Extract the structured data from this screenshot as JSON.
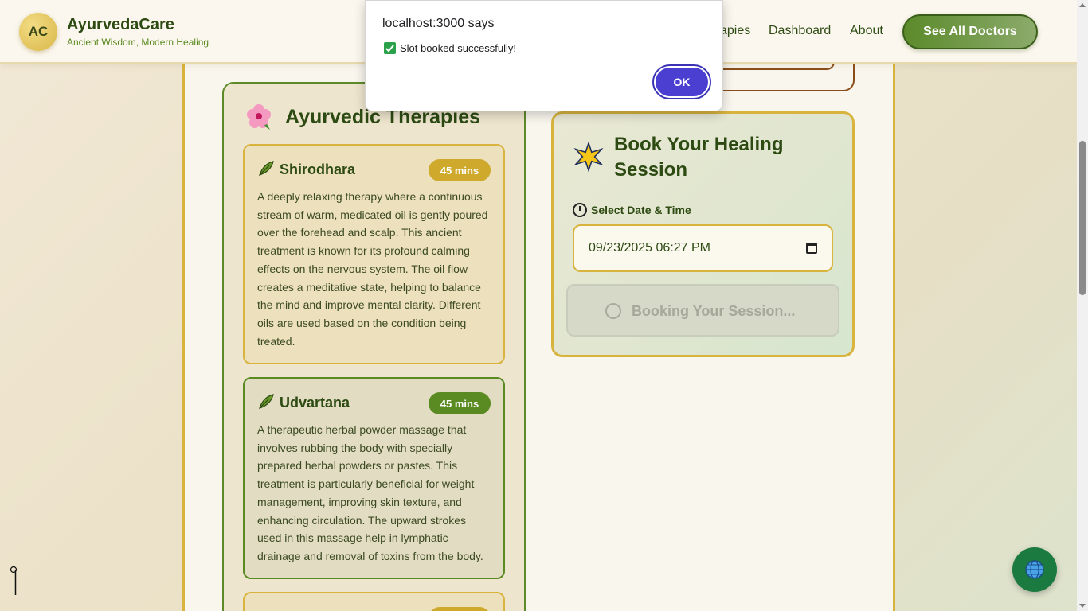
{
  "header": {
    "logo_initials": "AC",
    "brand_name": "AyurvedaCare",
    "tagline": "Ancient Wisdom, Modern Healing",
    "nav": [
      {
        "label": "apies"
      },
      {
        "label": "Dashboard"
      },
      {
        "label": "About"
      }
    ],
    "cta_label": "See All Doctors"
  },
  "therapies": {
    "title": "Ayurvedic Therapies",
    "title_icon": "hibiscus-icon",
    "items": [
      {
        "name": "Shirodhara",
        "duration": "45 mins",
        "description": "A deeply relaxing therapy where a continuous stream of warm, medicated oil is gently poured over the forehead and scalp. This ancient treatment is known for its profound calming effects on the nervous system. The oil flow creates a meditative state, helping to balance the mind and improve mental clarity. Different oils are used based on the condition being treated."
      },
      {
        "name": "Udvartana",
        "duration": "45 mins",
        "description": "A therapeutic herbal powder massage that involves rubbing the body with specially prepared herbal powders or pastes. This treatment is particularly beneficial for weight management, improving skin texture, and enhancing circulation. The upward strokes used in this massage help in lymphatic drainage and removal of toxins from the body."
      }
    ]
  },
  "booking": {
    "title": "Book Your Healing Session",
    "date_label": "Select Date & Time",
    "date_value": "09/23/2025 06:27 PM",
    "button_label": "Booking Your Session..."
  },
  "dialog": {
    "origin": "localhost:3000 says",
    "message": "Slot booked successfully!",
    "ok_label": "OK"
  },
  "colors": {
    "primary_green": "#5a8a22",
    "accent_gold": "#d8b43e",
    "dialog_button": "#4a3fd0",
    "globe_button": "#1a7a3f"
  }
}
